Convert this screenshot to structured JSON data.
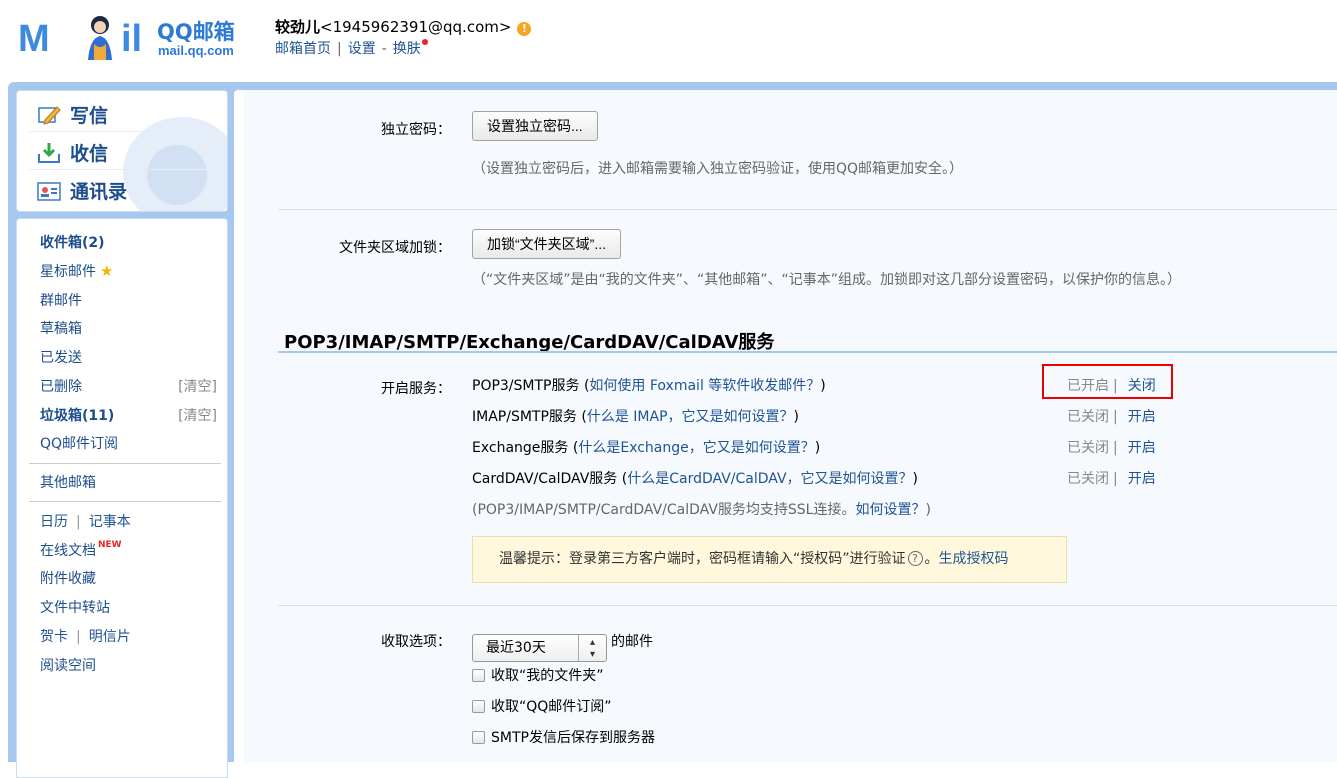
{
  "header": {
    "logo_mail": "M",
    "logo_il": "il",
    "logo_qq": "QQ邮箱",
    "logo_domain": "mail.qq.com",
    "nickname": "较劲儿",
    "email": "<1945962391@qq.com>",
    "warn": "!",
    "links": {
      "home": "邮箱首页",
      "settings": "设置",
      "skin": "换肤"
    },
    "sep1": "|",
    "sep2": "-"
  },
  "quick": {
    "write": "写信",
    "receive": "收信",
    "contacts": "通讯录"
  },
  "menu": {
    "inbox": "收件箱(2)",
    "starred": "星标邮件",
    "group": "群邮件",
    "drafts": "草稿箱",
    "sent": "已发送",
    "deleted": "已删除",
    "clear": "[清空]",
    "spam": "垃圾箱(11)",
    "subscribe": "QQ邮件订阅",
    "other": "其他邮箱",
    "calendar": "日历",
    "notes": "记事本",
    "docs": "在线文档",
    "new_tag": "NEW",
    "attachments": "附件收藏",
    "transfer": "文件中转站",
    "greeting": "贺卡",
    "postcard": "明信片",
    "reading": "阅读空间",
    "pipe": "|"
  },
  "security": {
    "pwd_label": "独立密码：",
    "pwd_button": "设置独立密码...",
    "pwd_hint": "（设置独立密码后，进入邮箱需要输入独立密码验证，使用QQ邮箱更加安全。）",
    "lock_label": "文件夹区域加锁：",
    "lock_button": "加锁“文件夹区域”...",
    "lock_hint": "（“文件夹区域”是由“我的文件夹”、“其他邮箱”、“记事本”组成。加锁即对这几部分设置密码，以保护你的信息。）"
  },
  "services": {
    "title": "POP3/IMAP/SMTP/Exchange/CardDAV/CalDAV服务",
    "label": "开启服务：",
    "items": [
      {
        "name": "POP3/SMTP服务",
        "link": "如何使用 Foxmail 等软件收发邮件？",
        "state": "已开启",
        "action": "关闭"
      },
      {
        "name": "IMAP/SMTP服务",
        "link": "什么是 IMAP，它又是如何设置？",
        "state": "已关闭",
        "action": "开启"
      },
      {
        "name": "Exchange服务",
        "link": "什么是Exchange，它又是如何设置？",
        "state": "已关闭",
        "action": "开启"
      },
      {
        "name": "CardDAV/CalDAV服务",
        "link": "什么是CardDAV/CalDAV，它又是如何设置？",
        "state": "已关闭",
        "action": "开启"
      }
    ],
    "ssl_note": "(POP3/IMAP/SMTP/CardDAV/CalDAV服务均支持SSL连接。",
    "ssl_link": "如何设置？",
    "ssl_close": ")",
    "paren_open": "(",
    "paren_close": ")",
    "state_sep": "|",
    "tip_text": "温馨提示：登录第三方客户端时，密码框请输入“授权码”进行验证",
    "tip_q": "?",
    "tip_dot": "。",
    "tip_link": "生成授权码"
  },
  "receive": {
    "label": "收取选项：",
    "select_value": "最近30天",
    "suffix": "的邮件",
    "options": [
      "收取“我的文件夹”",
      "收取“QQ邮件订阅”",
      "SMTP发信后保存到服务器"
    ]
  }
}
